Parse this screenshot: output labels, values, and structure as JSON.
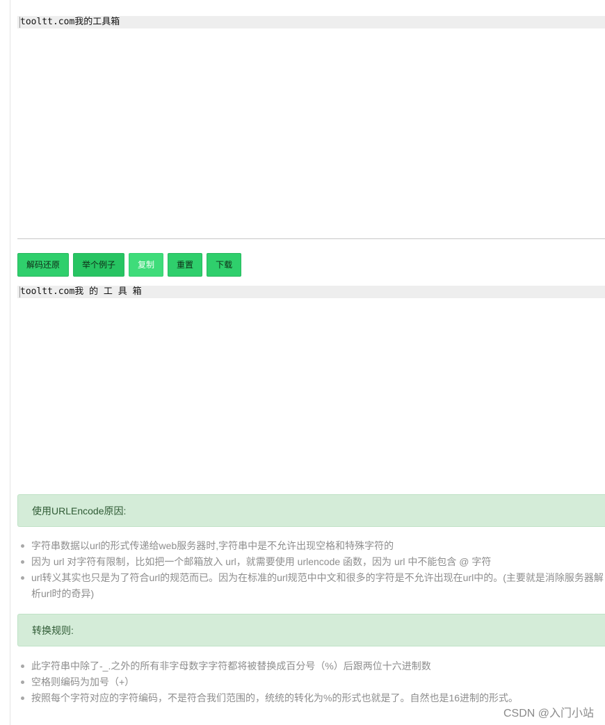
{
  "input_editor": {
    "value": "tooltt.com我的工具箱"
  },
  "toolbar": {
    "decode_label": "解码还原",
    "example_label": "举个例子",
    "copy_label": "复制",
    "reset_label": "重置",
    "download_label": "下载"
  },
  "output_editor": {
    "value": "tooltt.com我 的 工 具 箱"
  },
  "reasons": {
    "heading": "使用URLEncode原因:",
    "items": [
      "字符串数据以url的形式传递给web服务器时,字符串中是不允许出现空格和特殊字符的",
      "因为 url 对字符有限制，比如把一个邮箱放入 url，就需要使用 urlencode 函数，因为 url 中不能包含 @ 字符",
      "url转义其实也只是为了符合url的规范而已。因为在标准的url规范中中文和很多的字符是不允许出现在url中的。(主要就是消除服务器解析url时的奇异)"
    ]
  },
  "rules": {
    "heading": "转换规则:",
    "items": [
      "此字符串中除了-_.之外的所有非字母数字字符都将被替换成百分号（%）后跟两位十六进制数",
      "空格则编码为加号（+）",
      "按照每个字符对应的字符编码，不是符合我们范围的，统统的转化为%的形式也就是了。自然也是16进制的形式。"
    ]
  },
  "watermark": "CSDN @入门小站",
  "colors": {
    "button_green": "#2fcf6c",
    "panel_green": "#d4ecd8",
    "panel_text": "#2e5a34"
  }
}
